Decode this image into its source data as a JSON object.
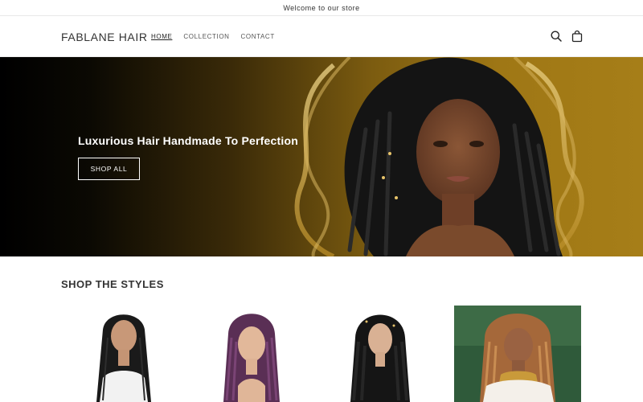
{
  "announcement": {
    "text": "Welcome to our store"
  },
  "header": {
    "logo": "FABLANE HAIR",
    "nav": [
      {
        "label": "HOME",
        "active": true
      },
      {
        "label": "COLLECTION",
        "active": false
      },
      {
        "label": "CONTACT",
        "active": false
      }
    ],
    "icons": [
      "search-icon",
      "cart-icon"
    ]
  },
  "hero": {
    "title": "Luxurious Hair Handmade To Perfection",
    "button_label": "SHOP ALL"
  },
  "styles_section": {
    "title": "SHOP THE STYLES",
    "products": [
      {
        "image": "straight-back-braids-wig"
      },
      {
        "image": "purple-box-braids-wig"
      },
      {
        "image": "faux-locs-wig"
      },
      {
        "image": "honey-blonde-braids"
      }
    ]
  },
  "colors": {
    "hero_gradient_start": "#000000",
    "hero_gradient_end": "#a67e18",
    "text": "#333333"
  }
}
